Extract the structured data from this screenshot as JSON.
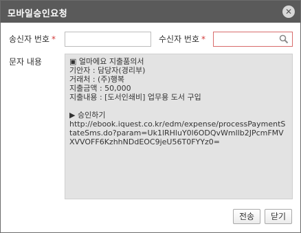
{
  "dialog": {
    "title": "모바일승인요청",
    "close_glyph": "✕"
  },
  "form": {
    "sender_label": "송신자 번호",
    "sender_required": "*",
    "sender_value": "",
    "receiver_label": "수신자 번호",
    "receiver_required": "*",
    "receiver_value": "",
    "message_label": "문자 내용",
    "message_text": "▣ 얼마에요 지출품의서\n기안자 : 담당자(경리부)\n거래처 : (주)행복\n지출금액 : 50,000\n지출내용 : [도서인쇄비] 업무용 도서 구입\n\n▶ 승인하기\nhttp://ebook.iquest.co.kr/edm/expense/processPaymentStateSms.do?param=Uk1lRHluY0l6ODQvWmllb2JPcmFMVXVVOFF6KzhhNDdEOC9jeU56T0FYYz0="
  },
  "buttons": {
    "send_label": "전송",
    "close_label": "닫기"
  },
  "colors": {
    "titlebar": "#5a5a5a",
    "required_mark": "#d23a3a",
    "focus_border": "#d86a6a",
    "message_bg": "#e3e3e3"
  }
}
